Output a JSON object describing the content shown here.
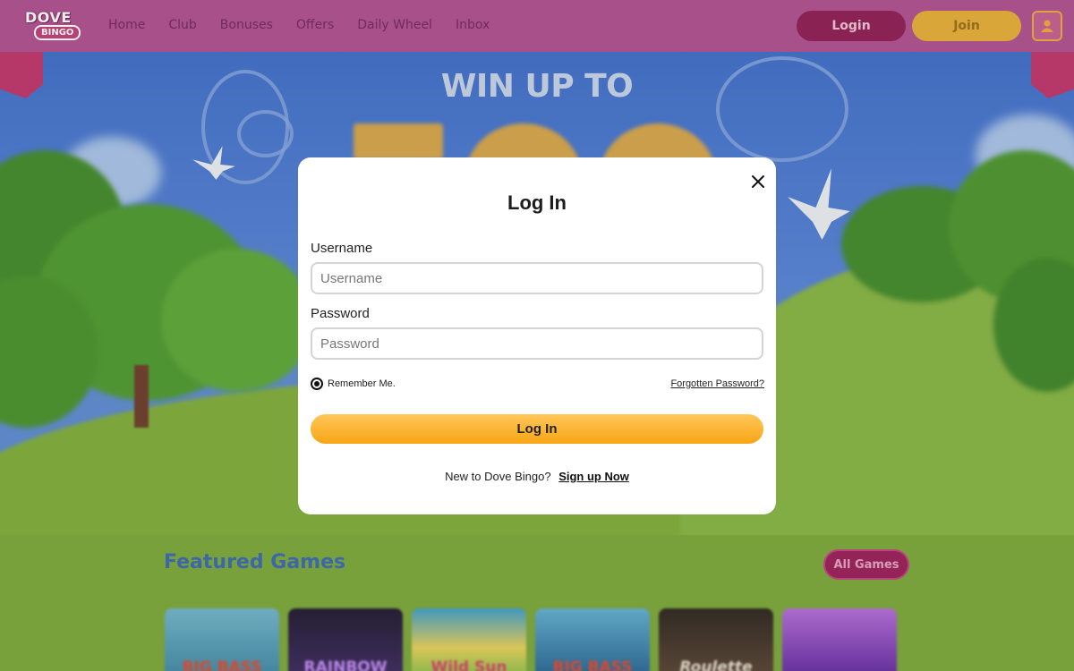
{
  "header": {
    "logo_top": "DOVE",
    "logo_bottom": "BINGO",
    "nav": [
      "Home",
      "Club",
      "Bonuses",
      "Offers",
      "Daily Wheel",
      "Inbox"
    ],
    "login_label": "Login",
    "join_label": "Join"
  },
  "hero": {
    "headline": "WIN UP TO"
  },
  "featured": {
    "title": "Featured Games",
    "all_games_label": "All Games",
    "games": [
      {
        "label": "BIG BASS",
        "color": "#5aa7c6"
      },
      {
        "label": "RAINBOW",
        "color": "#2a1d4a"
      },
      {
        "label": "Wild Sun",
        "color": "#d8c45a"
      },
      {
        "label": "BIG BASS",
        "color": "#2c6fa3"
      },
      {
        "label": "Roulette",
        "color": "#3a2a24"
      },
      {
        "label": "",
        "color": "#8a3ec0"
      }
    ]
  },
  "login_modal": {
    "title": "Log In",
    "username_label": "Username",
    "username_placeholder": "Username",
    "password_label": "Password",
    "password_placeholder": "Password",
    "remember_label": "Remember Me.",
    "forgot_label": "Forgotten Password?",
    "submit_label": "Log In",
    "signup_prompt": "New to Dove Bingo?",
    "signup_link": "Sign up Now"
  },
  "colors": {
    "header_bg": "#b14d93",
    "login_btn": "#8f1a56",
    "join_btn": "#e9b037",
    "submit_btn": "#f7a514"
  }
}
